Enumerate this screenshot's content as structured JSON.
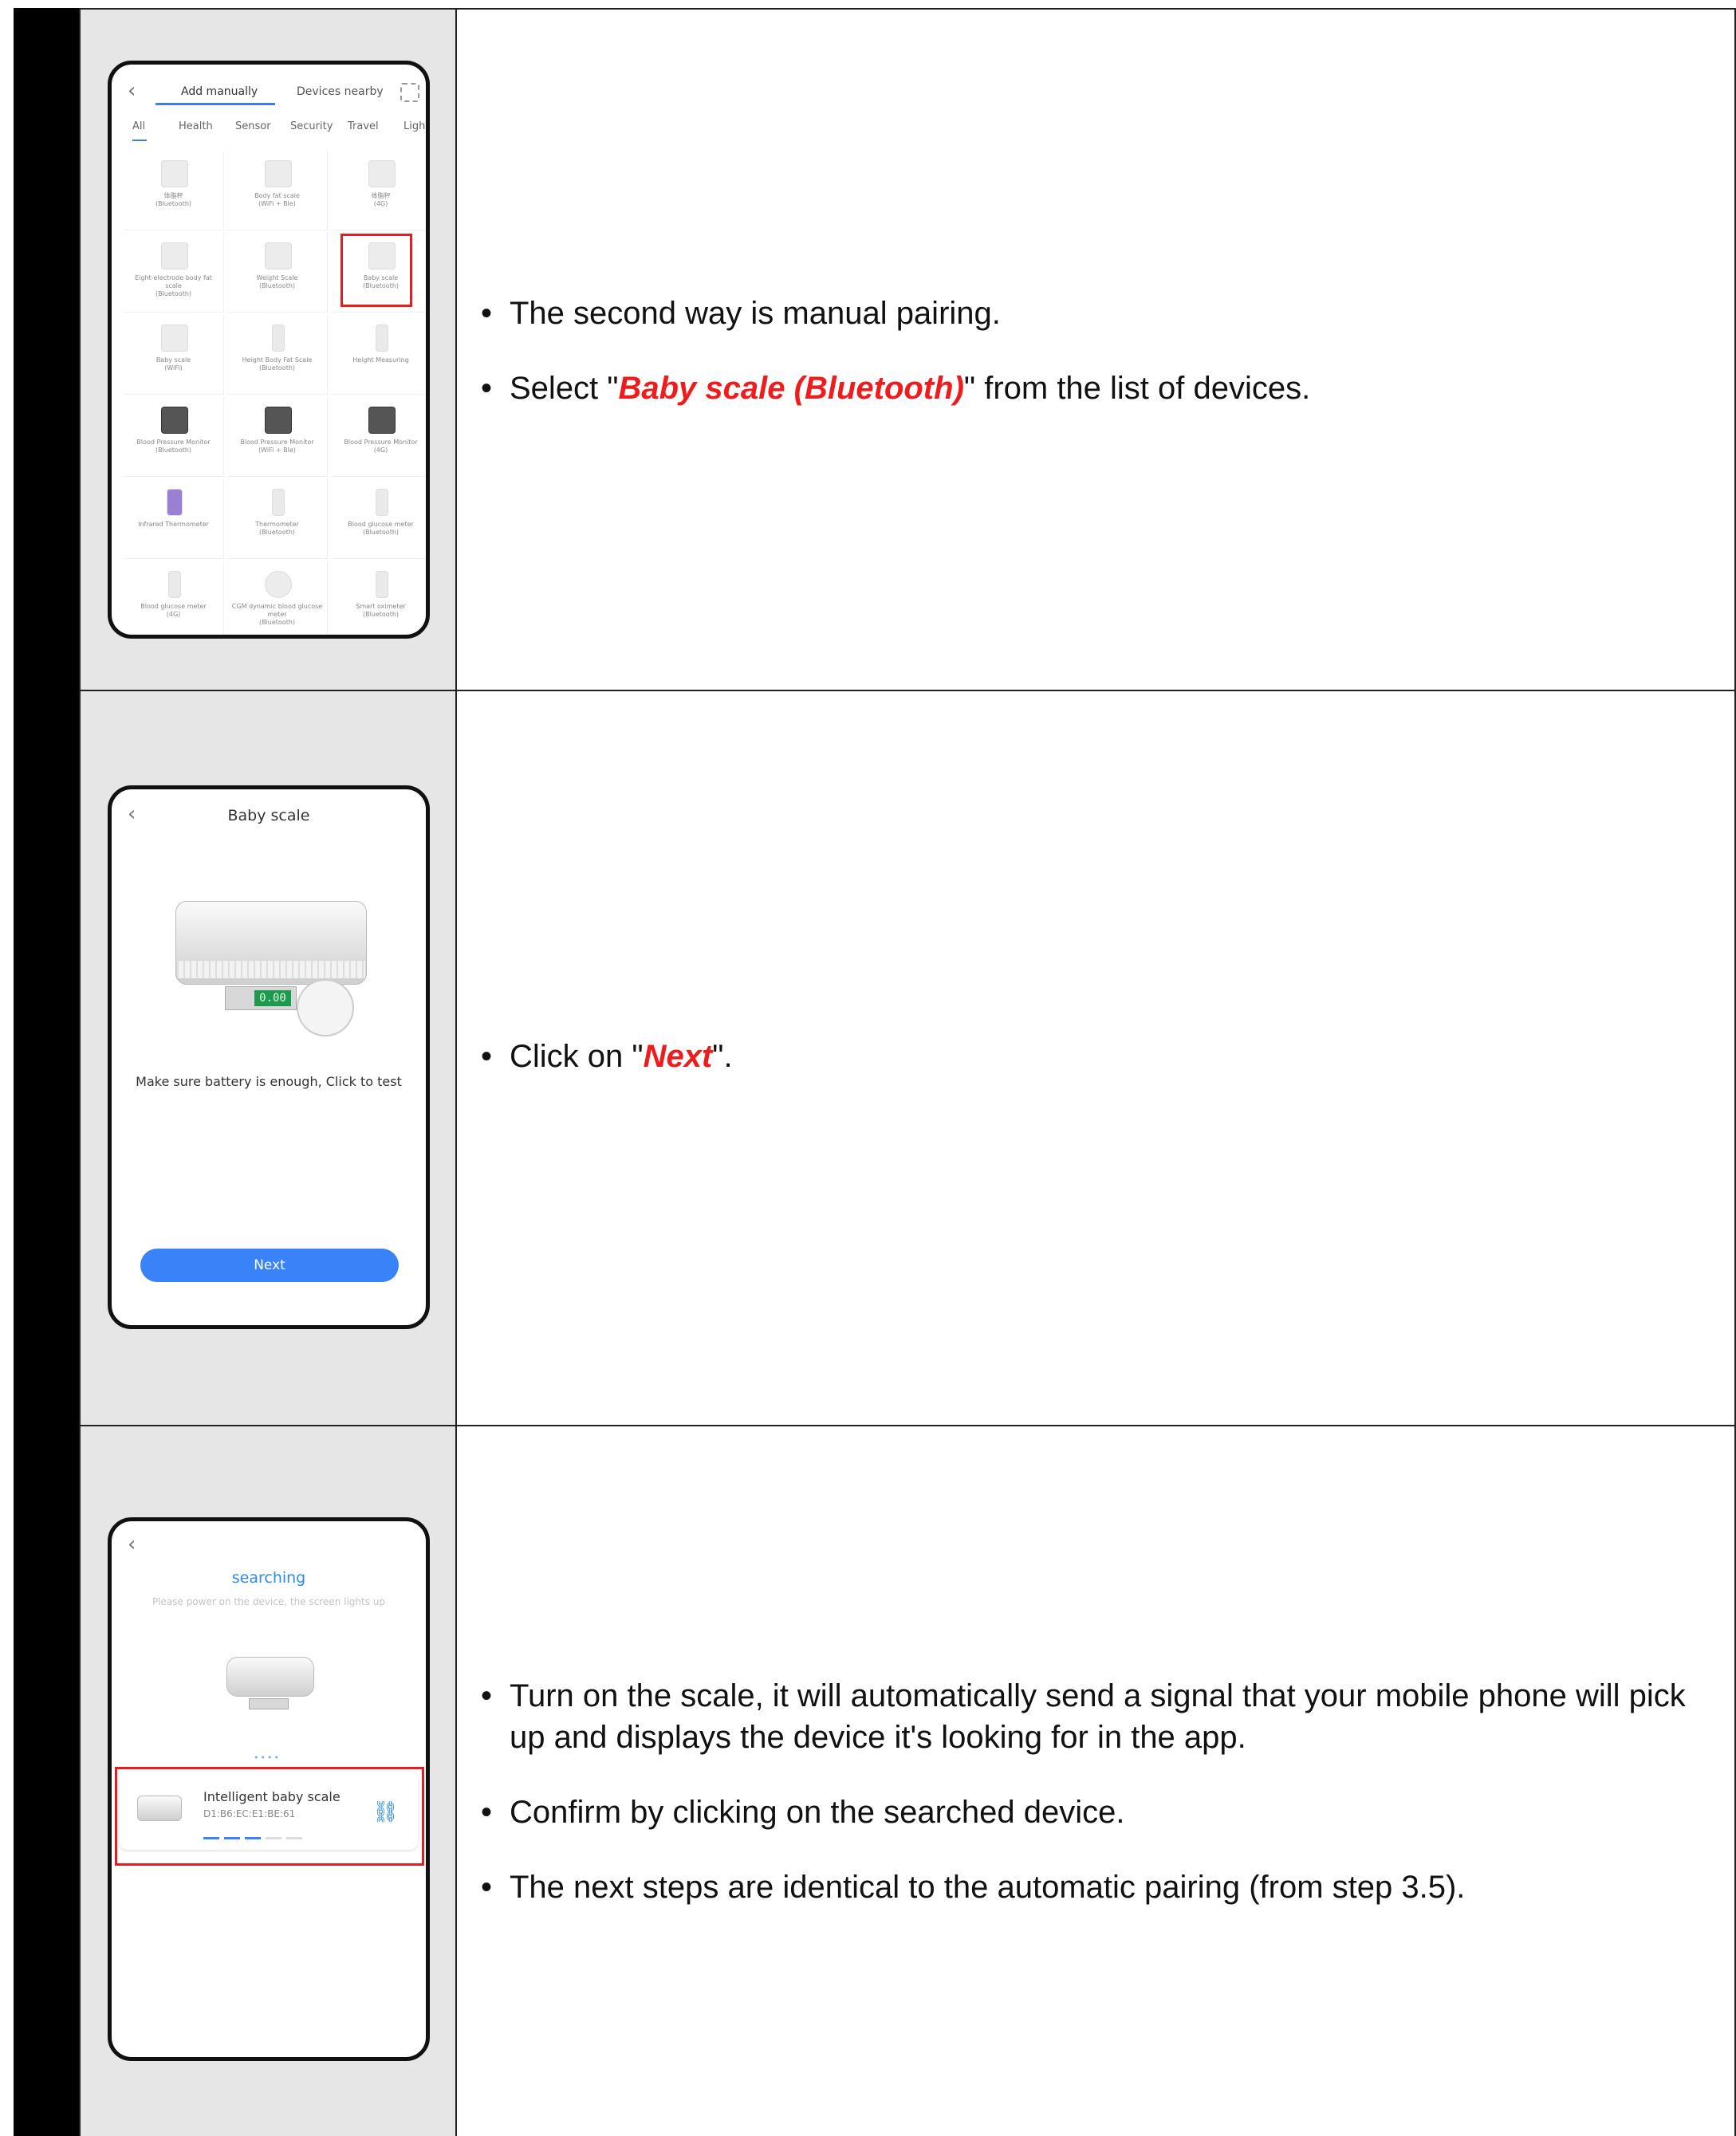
{
  "rows": [
    {
      "phone": {
        "tabs": [
          "Add manually",
          "Devices nearby"
        ],
        "categories": [
          "All",
          "Health",
          "Sensor",
          "Security",
          "Travel",
          "Light"
        ],
        "devices": [
          "体脂秤\n(Bluetooth)",
          "Body fat scale\n(WiFi + Ble)",
          "体脂秤\n(4G)",
          "Eight-electrode body fat\nscale\n(Bluetooth)",
          "Weight Scale\n(Bluetooth)",
          "Baby scale\n(Bluetooth)",
          "Baby scale\n(WiFi)",
          "Height Body Fat Scale\n(Bluetooth)",
          "Height Measuring",
          "Blood Pressure Monitor\n(Bluetooth)",
          "Blood Pressure Monitor\n(WiFi + Ble)",
          "Blood Pressure Monitor\n(4G)",
          "Infrared Thermometer",
          "Thermometer\n(Bluetooth)",
          "Blood glucose meter\n(Bluetooth)",
          "Blood glucose meter\n(4G)",
          "CGM dynamic blood glucose\nmeter\n(Bluetooth)",
          "Smart oximeter\n(Bluetooth)"
        ]
      },
      "text": {
        "bullet1": "The second way is manual pairing.",
        "bullet2_prefix": "Select \"",
        "bullet2_highlight": "Baby scale (Bluetooth)",
        "bullet2_suffix": "\" from the list of devices."
      }
    },
    {
      "phone": {
        "title": "Baby scale",
        "lcd": "0.00",
        "message": "Make sure battery is enough, Click to test",
        "button": "Next"
      },
      "text": {
        "bullet1_prefix": "Click on \"",
        "bullet1_highlight": "Next",
        "bullet1_suffix": "\"."
      }
    },
    {
      "phone": {
        "title": "searching",
        "subtitle": "Please power on the device, the screen lights up",
        "device_name": "Intelligent baby scale",
        "device_mac": "D1:B6:EC:E1:BE:61"
      },
      "text": {
        "bullet1": "Turn on the scale, it will automatically send a signal that your mobile phone will pick up and displays the device it's looking for in the app.",
        "bullet2": "Confirm by clicking on the searched device.",
        "bullet3": "The next steps are identical to the automatic pairing (from step 3.5)."
      }
    }
  ],
  "colors": {
    "highlight": "#ee1c1c",
    "accent": "#3a82f7",
    "cell_bg": "#e6e6e6"
  },
  "icons": [
    "back-icon",
    "scan-icon",
    "link-icon"
  ]
}
